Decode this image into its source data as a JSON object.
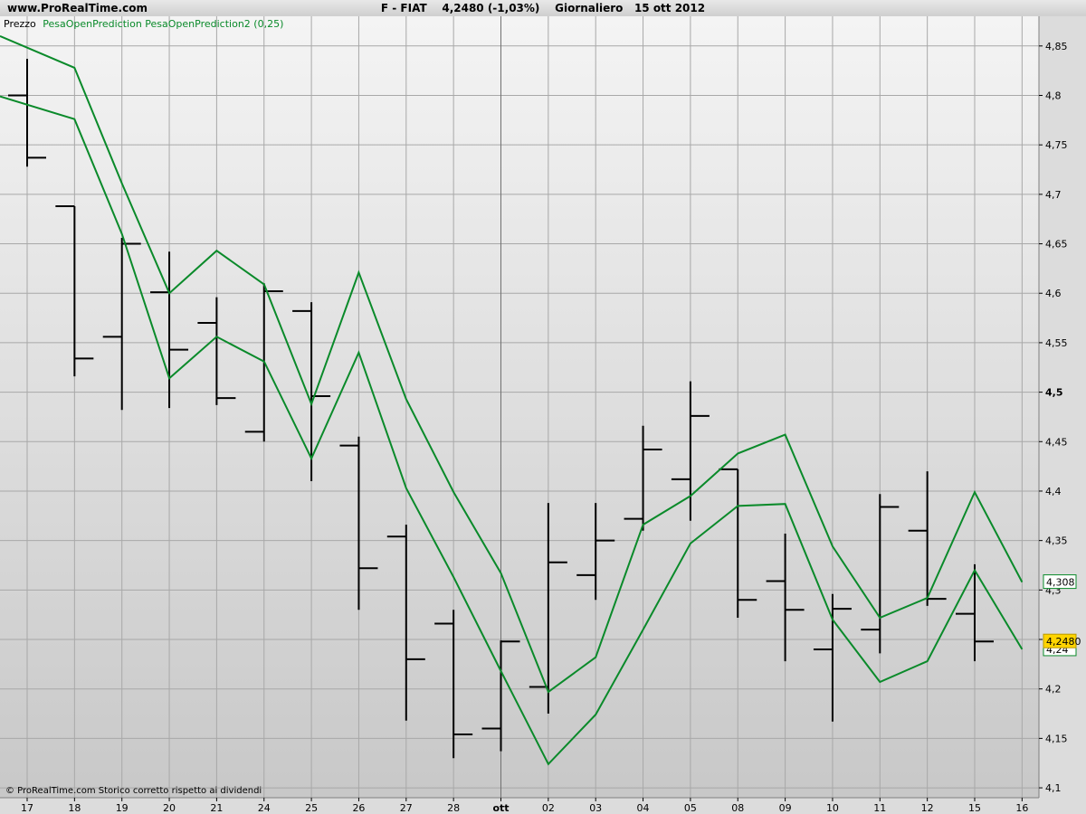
{
  "site": "www.ProRealTime.com",
  "headline": "F - FIAT    4,2480 (-1,03%)    Giornaliero   15 ott 2012",
  "legend": {
    "price": "Prezzo",
    "indicators": "PesaOpenPrediction PesaOpenPrediction2 (0,25)"
  },
  "footnote": "© ProRealTime.com  Storico corretto rispetto ai dividendi",
  "colors": {
    "background_top": "#f4f4f4",
    "background_bottom": "#c8c8c8",
    "grid": "#a8a8a8",
    "bars": "#000000",
    "indicator": "#0a8a2a",
    "price_badge": "#ffd400"
  },
  "chart_data": {
    "type": "line",
    "ylim": [
      4.09,
      4.88
    ],
    "yticks": [
      "4,1",
      "4,15",
      "4,2",
      "4,25",
      "4,3",
      "4,35",
      "4,4",
      "4,45",
      "4,5",
      "4,55",
      "4,6",
      "4,65",
      "4,7",
      "4,75",
      "4,8",
      "4,85"
    ],
    "bold_ytick": "4,5",
    "categories": [
      "17",
      "18",
      "19",
      "20",
      "21",
      "24",
      "25",
      "26",
      "27",
      "28",
      "ott",
      "02",
      "03",
      "04",
      "05",
      "08",
      "09",
      "10",
      "11",
      "12",
      "15",
      "16"
    ],
    "ohlc": [
      {
        "open": 4.8,
        "high": 4.837,
        "low": 4.728,
        "close": 4.737
      },
      {
        "open": 4.688,
        "high": 4.688,
        "low": 4.516,
        "close": 4.534
      },
      {
        "open": 4.556,
        "high": 4.656,
        "low": 4.482,
        "close": 4.65
      },
      {
        "open": 4.601,
        "high": 4.642,
        "low": 4.484,
        "close": 4.543
      },
      {
        "open": 4.57,
        "high": 4.596,
        "low": 4.487,
        "close": 4.494
      },
      {
        "open": 4.46,
        "high": 4.61,
        "low": 4.45,
        "close": 4.602
      },
      {
        "open": 4.582,
        "high": 4.591,
        "low": 4.41,
        "close": 4.496
      },
      {
        "open": 4.446,
        "high": 4.455,
        "low": 4.28,
        "close": 4.322
      },
      {
        "open": 4.354,
        "high": 4.366,
        "low": 4.168,
        "close": 4.23
      },
      {
        "open": 4.266,
        "high": 4.28,
        "low": 4.13,
        "close": 4.154
      },
      {
        "open": 4.16,
        "high": 4.249,
        "low": 4.137,
        "close": 4.248
      },
      {
        "open": 4.202,
        "high": 4.388,
        "low": 4.175,
        "close": 4.328
      },
      {
        "open": 4.315,
        "high": 4.388,
        "low": 4.29,
        "close": 4.35
      },
      {
        "open": 4.372,
        "high": 4.466,
        "low": 4.36,
        "close": 4.442
      },
      {
        "open": 4.412,
        "high": 4.511,
        "low": 4.37,
        "close": 4.476
      },
      {
        "open": 4.422,
        "high": 4.422,
        "low": 4.272,
        "close": 4.29
      },
      {
        "open": 4.309,
        "high": 4.357,
        "low": 4.228,
        "close": 4.28
      },
      {
        "open": 4.24,
        "high": 4.296,
        "low": 4.167,
        "close": 4.281
      },
      {
        "open": 4.26,
        "high": 4.397,
        "low": 4.236,
        "close": 4.384
      },
      {
        "open": 4.36,
        "high": 4.42,
        "low": 4.284,
        "close": 4.291
      },
      {
        "open": 4.276,
        "high": 4.326,
        "low": 4.228,
        "close": 4.248
      }
    ],
    "series": [
      {
        "values": [
          4.86,
          4.828,
          4.711,
          4.6,
          4.643,
          4.609,
          4.488,
          4.621,
          4.493,
          4.399,
          4.317,
          4.197,
          4.232,
          4.366,
          4.395,
          4.438,
          4.457,
          4.344,
          4.272,
          4.292,
          4.399,
          4.308
        ]
      },
      {
        "values": [
          4.799,
          4.776,
          4.66,
          4.514,
          4.556,
          4.531,
          4.433,
          4.54,
          4.403,
          4.313,
          4.218,
          4.124,
          4.174,
          4.26,
          4.347,
          4.385,
          4.387,
          4.27,
          4.207,
          4.228,
          4.32,
          4.24
        ]
      }
    ],
    "last_labels": {
      "indicator_1": "4,308",
      "indicator_2": "4,24",
      "price": "4,2480"
    }
  }
}
